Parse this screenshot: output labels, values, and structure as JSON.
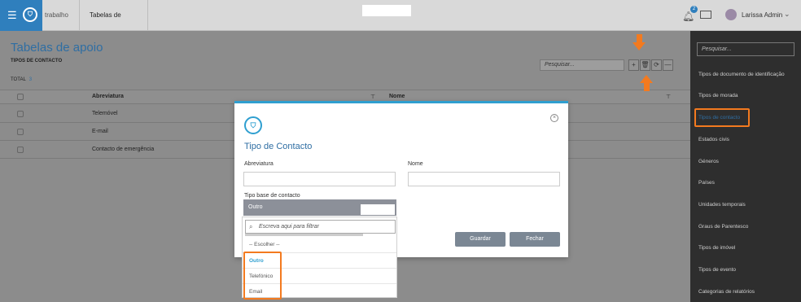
{
  "topbar": {
    "tabs": [
      "trabalho",
      "Tabelas de apoio"
    ],
    "notifications_count": "2",
    "user_name": "Larissa Admin"
  },
  "main": {
    "title": "Tabelas de apoio",
    "subtitle": "TIPOS DE CONTACTO",
    "total_label": "TOTAL",
    "total_value": "3",
    "search_placeholder": "Pesquisar...",
    "toolbar": [
      "+",
      "🗑",
      "⟳",
      "—"
    ],
    "columns": [
      "Abreviatura",
      "Nome"
    ],
    "rows": [
      "Telemóvel",
      "E-mail",
      "Contacto de emergência"
    ]
  },
  "sidebar": {
    "search_placeholder": "Pesquisar...",
    "items": [
      "Tipos de documento de identificação",
      "Tipos de morada",
      "Tipos de contacto",
      "Estados civis",
      "Géneros",
      "Países",
      "Unidades temporais",
      "Graus de Parentesco",
      "Tipos de imóvel",
      "Tipos de evento",
      "Categorias de relatórios"
    ]
  },
  "modal": {
    "title": "Tipo de Contacto",
    "field_abreviatura": "Abreviatura",
    "field_nome": "Nome",
    "field_tipo_base": "Tipo base de contacto",
    "selected_value": "Outro",
    "filter_placeholder": "Escreva aqui para filtrar",
    "options": [
      "-- Escolher --",
      "Outro",
      "Telefónico",
      "Email"
    ],
    "save_label": "Guardar",
    "close_label": "Fechar"
  },
  "colors": {
    "accent": "#2f6ea3",
    "highlight": "#f37a1f",
    "sidebar_bg": "#2e2e2e"
  }
}
